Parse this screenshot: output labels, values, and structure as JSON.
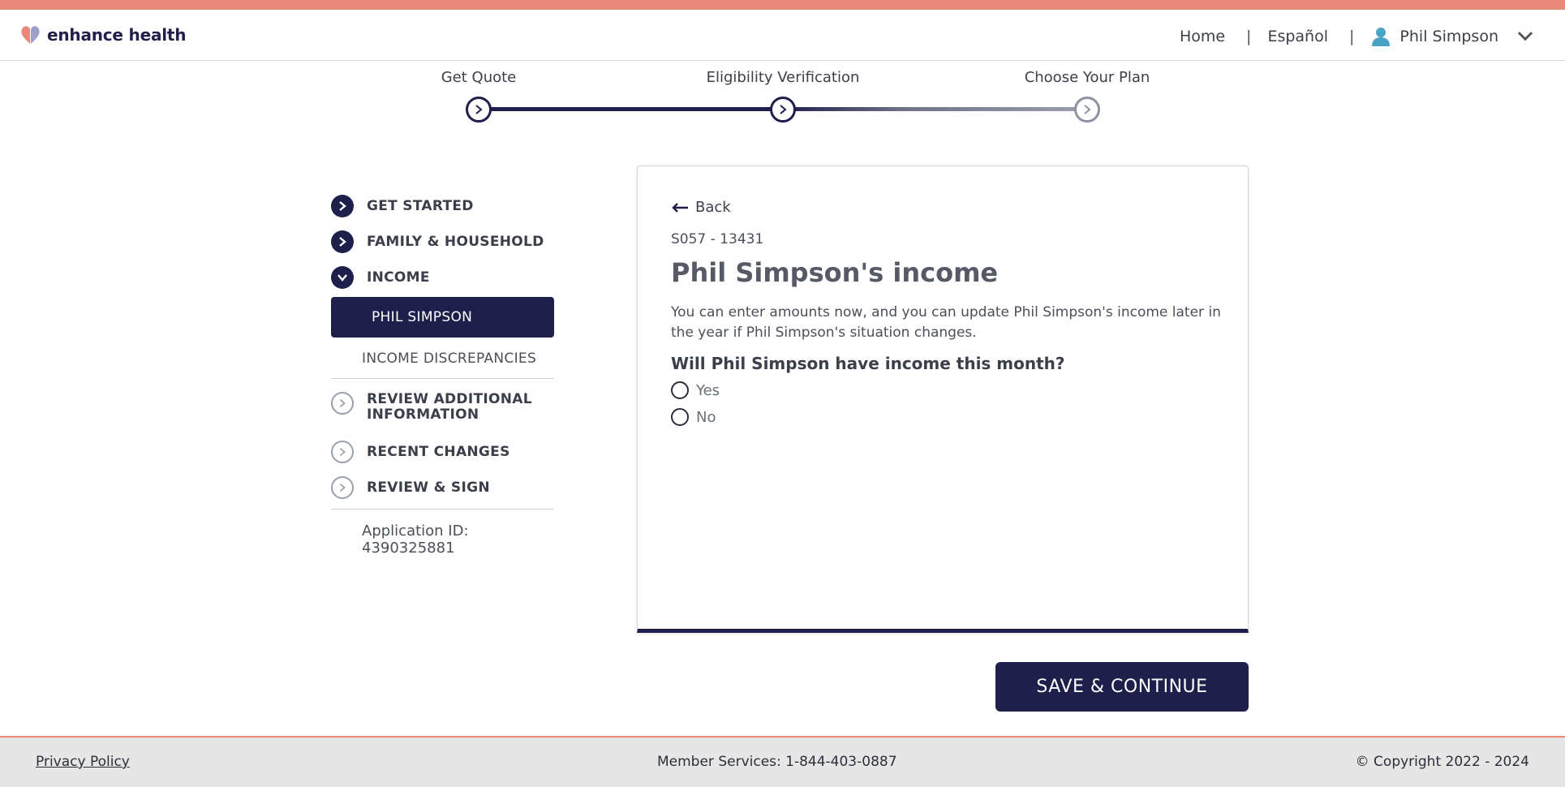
{
  "brand": {
    "name": "enhance health",
    "accent": "#e8887a",
    "primary": "#1e1f4b"
  },
  "nav": {
    "home": "Home",
    "language": "Español",
    "separator": "|",
    "user_name": "Phil Simpson"
  },
  "progress": {
    "steps": [
      {
        "label": "Get Quote",
        "state": "complete"
      },
      {
        "label": "Eligibility Verification",
        "state": "current"
      },
      {
        "label": "Choose Your Plan",
        "state": "upcoming"
      }
    ]
  },
  "sidebar": {
    "items": [
      {
        "label": "GET STARTED",
        "icon": "chevron-right-icon",
        "state": "complete"
      },
      {
        "label": "FAMILY & HOUSEHOLD",
        "icon": "chevron-right-icon",
        "state": "complete"
      },
      {
        "label": "INCOME",
        "icon": "chevron-down-icon",
        "state": "expanded"
      }
    ],
    "income_sub": {
      "active": "PHIL SIMPSON",
      "other": "INCOME DISCREPANCIES"
    },
    "later_items": [
      {
        "label": "REVIEW ADDITIONAL INFORMATION",
        "line1": "REVIEW ADDITIONAL",
        "line2": "INFORMATION"
      },
      {
        "label": "RECENT CHANGES"
      },
      {
        "label": "REVIEW & SIGN"
      }
    ],
    "application_id": "Application ID: 4390325881"
  },
  "card": {
    "back_label": "Back",
    "code": "S057 - 13431",
    "title": "Phil Simpson's income",
    "description": "You can enter amounts now, and you can update Phil Simpson's income later in the year if Phil Simpson's situation changes.",
    "question": "Will Phil Simpson have income this month?",
    "options": [
      "Yes",
      "No"
    ]
  },
  "actions": {
    "save_label": "SAVE & CONTINUE"
  },
  "footer": {
    "privacy": "Privacy Policy",
    "member_services": "Member Services: 1-844-403-0887",
    "copyright": "© Copyright 2022 - 2024"
  }
}
